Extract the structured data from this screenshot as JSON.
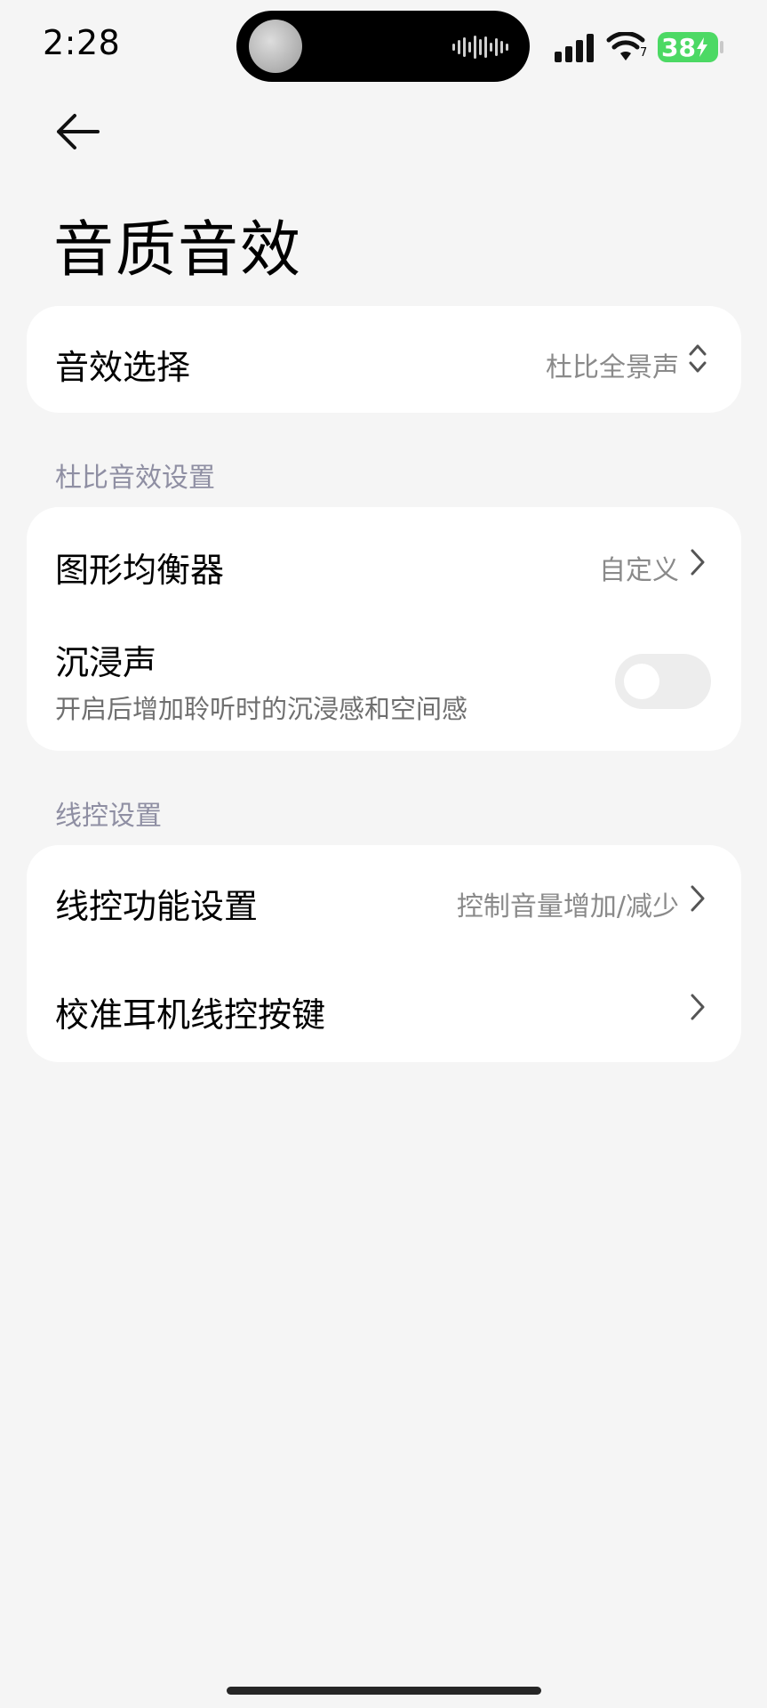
{
  "status_bar": {
    "time": "2:28",
    "battery": "38",
    "wifi_sub": "7"
  },
  "header": {
    "back_label": "",
    "title": "音质音效"
  },
  "sound_effect_card": {
    "label": "音效选择",
    "value": "杜比全景声"
  },
  "dolby_section": {
    "title": "杜比音效设置",
    "equalizer": {
      "label": "图形均衡器",
      "value": "自定义"
    },
    "immersive": {
      "label": "沉浸声",
      "description": "开启后增加聆听时的沉浸感和空间感",
      "enabled": false
    }
  },
  "wire_section": {
    "title": "线控设置",
    "function": {
      "label": "线控功能设置",
      "value": "控制音量增加/减少"
    },
    "calibrate": {
      "label": "校准耳机线控按键"
    }
  }
}
